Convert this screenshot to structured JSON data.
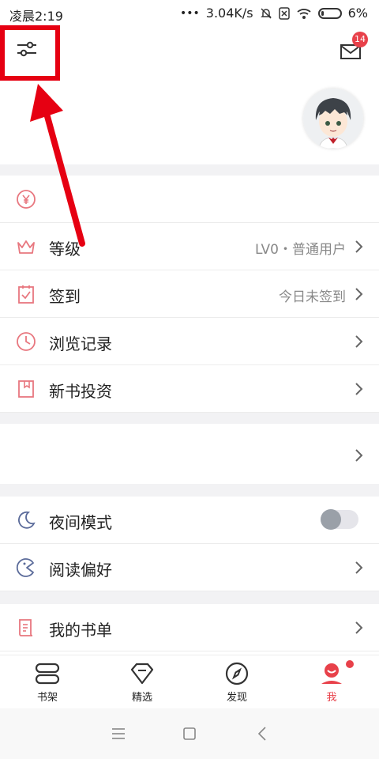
{
  "status_bar": {
    "time": "凌晨2:19",
    "network_speed": "3.04K/s",
    "battery": "6%"
  },
  "header": {
    "mail_badge": "14"
  },
  "menu": {
    "wallet": {
      "label": "",
      "icon": "yuan-icon"
    },
    "level": {
      "label": "等级",
      "value": "LV0・普通用户",
      "icon": "crown-icon"
    },
    "checkin": {
      "label": "签到",
      "value": "今日未签到",
      "icon": "calendar-check-icon"
    },
    "history": {
      "label": "浏览记录",
      "icon": "clock-icon"
    },
    "invest": {
      "label": "新书投资",
      "icon": "bookmark-icon"
    },
    "night_mode": {
      "label": "夜间模式",
      "icon": "moon-icon",
      "enabled": false
    },
    "reading_pref": {
      "label": "阅读偏好",
      "icon": "pacman-icon"
    },
    "booklist": {
      "label": "我的书单",
      "icon": "booklist-icon"
    }
  },
  "tabs": [
    {
      "label": "书架",
      "icon": "bookshelf-icon"
    },
    {
      "label": "精选",
      "icon": "diamond-icon"
    },
    {
      "label": "发现",
      "icon": "compass-icon"
    },
    {
      "label": "我",
      "icon": "profile-icon",
      "active": true
    }
  ],
  "colors": {
    "accent": "#e8414a",
    "annotation": "#e60012",
    "icon_red": "#e8777f",
    "icon_blue": "#5b6b9a"
  }
}
